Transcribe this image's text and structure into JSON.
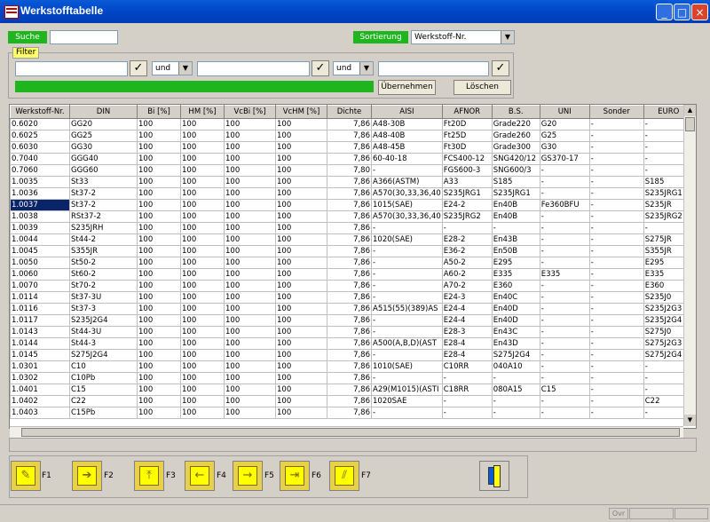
{
  "window": {
    "title": "Werkstofftabelle"
  },
  "search": {
    "label": "Suche",
    "value": ""
  },
  "sort": {
    "label": "Sortierung",
    "selected": "Werkstoff-Nr."
  },
  "filter": {
    "label": "Filter",
    "op1": "und",
    "op2": "und",
    "apply_label": "Übernehmen",
    "clear_label": "Löschen"
  },
  "table": {
    "columns": [
      "Werkstoff-Nr.",
      "DIN",
      "Bi [%]",
      "HM [%]",
      "VcBi [%]",
      "VcHM [%]",
      "Dichte",
      "AISI",
      "AFNOR",
      "B.S.",
      "UNI",
      "Sonder",
      "EURO"
    ],
    "rows": [
      [
        "0.6020",
        "GG20",
        "100",
        "100",
        "100",
        "100",
        "7,86",
        "A48-30B",
        "Ft20D",
        "Grade220",
        "G20",
        "-",
        "-"
      ],
      [
        "0.6025",
        "GG25",
        "100",
        "100",
        "100",
        "100",
        "7,86",
        "A48-40B",
        "Ft25D",
        "Grade260",
        "G25",
        "-",
        "-"
      ],
      [
        "0.6030",
        "GG30",
        "100",
        "100",
        "100",
        "100",
        "7,86",
        "A48-45B",
        "Ft30D",
        "Grade300",
        "G30",
        "-",
        "-"
      ],
      [
        "0.7040",
        "GGG40",
        "100",
        "100",
        "100",
        "100",
        "7,86",
        "60-40-18",
        "FCS400-12",
        "SNG420/12",
        "GS370-17",
        "-",
        "-"
      ],
      [
        "0.7060",
        "GGG60",
        "100",
        "100",
        "100",
        "100",
        "7,80",
        "-",
        "FGS600-3",
        "SNG600/3",
        "-",
        "-",
        "-"
      ],
      [
        "1.0035",
        "St33",
        "100",
        "100",
        "100",
        "100",
        "7,86",
        "A366(ASTM)",
        "A33",
        "S185",
        "-",
        "-",
        "S185"
      ],
      [
        "1.0036",
        "St37-2",
        "100",
        "100",
        "100",
        "100",
        "7,86",
        "A570(30,33,36,40",
        "S235JRG1",
        "S235JRG1",
        "-",
        "-",
        "S235JRG1"
      ],
      [
        "1.0037",
        "St37-2",
        "100",
        "100",
        "100",
        "100",
        "7,86",
        "1015(SAE)",
        "E24-2",
        "En40B",
        "Fe360BFU",
        "-",
        "S235JR"
      ],
      [
        "1.0038",
        "RSt37-2",
        "100",
        "100",
        "100",
        "100",
        "7,86",
        "A570(30,33,36,40",
        "S235JRG2",
        "En40B",
        "-",
        "-",
        "S235JRG2"
      ],
      [
        "1.0039",
        "S235JRH",
        "100",
        "100",
        "100",
        "100",
        "7,86",
        "-",
        "-",
        "-",
        "-",
        "-",
        "-"
      ],
      [
        "1.0044",
        "St44-2",
        "100",
        "100",
        "100",
        "100",
        "7,86",
        "1020(SAE)",
        "E28-2",
        "En43B",
        "-",
        "-",
        "S275JR"
      ],
      [
        "1.0045",
        "S355JR",
        "100",
        "100",
        "100",
        "100",
        "7,86",
        "-",
        "E36-2",
        "En50B",
        "-",
        "-",
        "S355JR"
      ],
      [
        "1.0050",
        "St50-2",
        "100",
        "100",
        "100",
        "100",
        "7,86",
        "-",
        "A50-2",
        "E295",
        "-",
        "-",
        "E295"
      ],
      [
        "1.0060",
        "St60-2",
        "100",
        "100",
        "100",
        "100",
        "7,86",
        "-",
        "A60-2",
        "E335",
        "E335",
        "-",
        "E335"
      ],
      [
        "1.0070",
        "St70-2",
        "100",
        "100",
        "100",
        "100",
        "7,86",
        "-",
        "A70-2",
        "E360",
        "-",
        "-",
        "E360"
      ],
      [
        "1.0114",
        "St37-3U",
        "100",
        "100",
        "100",
        "100",
        "7,86",
        "-",
        "E24-3",
        "En40C",
        "-",
        "-",
        "S235J0"
      ],
      [
        "1.0116",
        "St37-3",
        "100",
        "100",
        "100",
        "100",
        "7,86",
        "A515(55)(389)AS",
        "E24-4",
        "En40D",
        "-",
        "-",
        "S235J2G3"
      ],
      [
        "1.0117",
        "S235J2G4",
        "100",
        "100",
        "100",
        "100",
        "7,86",
        "-",
        "E24-4",
        "En40D",
        "-",
        "-",
        "S235J2G4"
      ],
      [
        "1.0143",
        "St44-3U",
        "100",
        "100",
        "100",
        "100",
        "7,86",
        "-",
        "E28-3",
        "En43C",
        "-",
        "-",
        "S275J0"
      ],
      [
        "1.0144",
        "St44-3",
        "100",
        "100",
        "100",
        "100",
        "7,86",
        "A500(A,B,D)(AST",
        "E28-4",
        "En43D",
        "-",
        "-",
        "S275J2G3"
      ],
      [
        "1.0145",
        "S275J2G4",
        "100",
        "100",
        "100",
        "100",
        "7,86",
        "-",
        "E28-4",
        "S275J2G4",
        "-",
        "-",
        "S275J2G4"
      ],
      [
        "1.0301",
        "C10",
        "100",
        "100",
        "100",
        "100",
        "7,86",
        "1010(SAE)",
        "C10RR",
        "040A10",
        "-",
        "-",
        "-"
      ],
      [
        "1.0302",
        "C10Pb",
        "100",
        "100",
        "100",
        "100",
        "7,86",
        "-",
        "-",
        "-",
        "-",
        "-",
        "-"
      ],
      [
        "1.0401",
        "C15",
        "100",
        "100",
        "100",
        "100",
        "7,86",
        "A29(M1015)(ASTI",
        "C18RR",
        "080A15",
        "C15",
        "-",
        "-"
      ],
      [
        "1.0402",
        "C22",
        "100",
        "100",
        "100",
        "100",
        "7,86",
        "1020SAE",
        "-",
        "-",
        "-",
        "-",
        "C22"
      ],
      [
        "1.0403",
        "C15Pb",
        "100",
        "100",
        "100",
        "100",
        "7,86",
        "-",
        "-",
        "-",
        "-",
        "-",
        "-"
      ]
    ],
    "selected_index": 7
  },
  "toolbar": {
    "f1": "F1",
    "f2": "F2",
    "f3": "F3",
    "f4": "F4",
    "f5": "F5",
    "f6": "F6",
    "f7": "F7"
  },
  "status": {
    "ovr": "Ovr"
  }
}
